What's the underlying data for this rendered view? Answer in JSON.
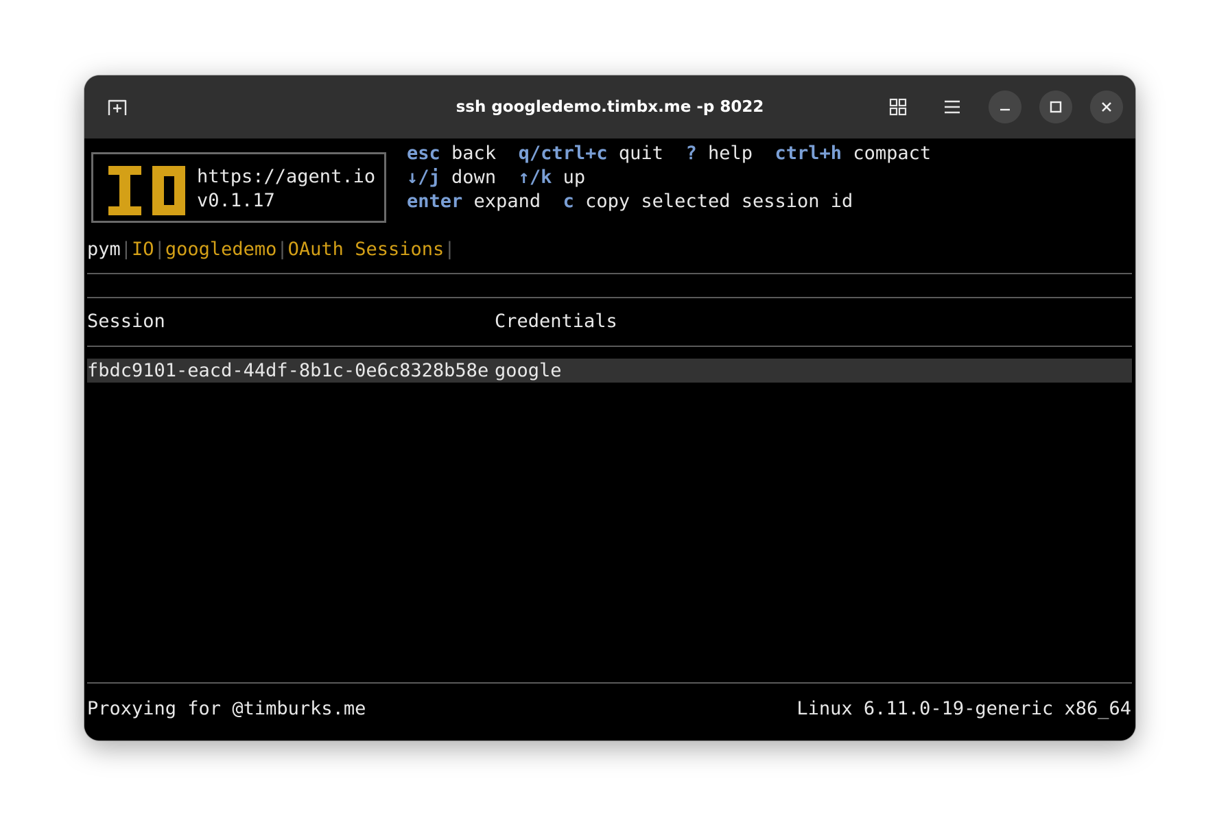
{
  "window": {
    "title": "ssh googledemo.timbx.me -p 8022"
  },
  "titlebar_icons": {
    "new_tab": "new-tab-icon",
    "grid": "grid-view-icon",
    "menu": "hamburger-menu-icon",
    "minimize": "minimize-icon",
    "maximize": "maximize-icon",
    "close": "close-icon"
  },
  "colors": {
    "accent_gold": "#d4a017",
    "key_blue": "#7a9fd6",
    "selection_bg": "#333333"
  },
  "logo": {
    "url": "https://agent.io",
    "version": "v0.1.17"
  },
  "help": {
    "rows": [
      [
        {
          "key": "esc",
          "action": "back"
        },
        {
          "key": "q/ctrl+c",
          "action": "quit"
        },
        {
          "key": "?",
          "action": "help"
        },
        {
          "key": "ctrl+h",
          "action": "compact"
        }
      ],
      [
        {
          "key": "↓/j",
          "action": "down"
        },
        {
          "key": "↑/k",
          "action": "up"
        }
      ],
      [
        {
          "key": "enter",
          "action": "expand"
        },
        {
          "key": "c",
          "action": "copy selected session id"
        }
      ]
    ]
  },
  "breadcrumb": {
    "items": [
      "pym",
      "IO",
      "googledemo",
      "OAuth Sessions"
    ],
    "separator": "|"
  },
  "table": {
    "headers": [
      "Session",
      "Credentials"
    ],
    "rows": [
      {
        "session": "fbdc9101-eacd-44df-8b1c-0e6c8328b58e",
        "credentials": "google",
        "selected": true
      }
    ]
  },
  "status_bar": {
    "left": "Proxying for @timburks.me",
    "right": "Linux 6.11.0-19-generic x86_64"
  }
}
